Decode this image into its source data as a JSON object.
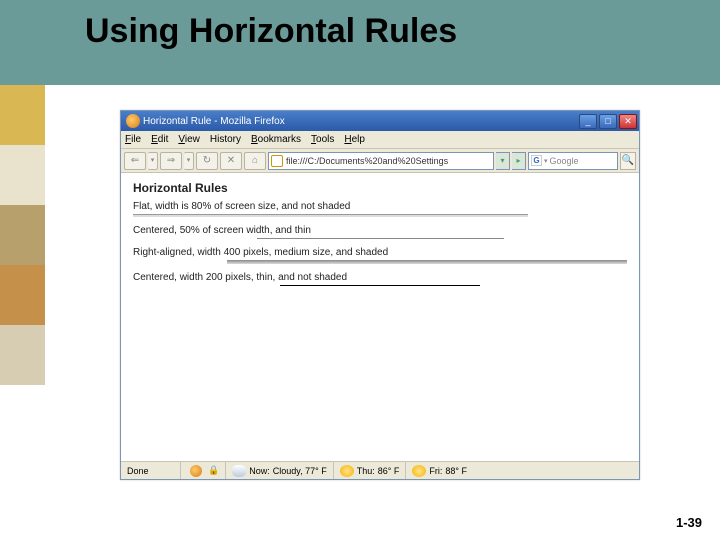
{
  "slide": {
    "title": "Using Horizontal Rules",
    "pagenum": "1-39"
  },
  "sidebar_colors": [
    "#d9b854",
    "#e9e2cc",
    "#b8a06c",
    "#c4904a",
    "#d6cdb2"
  ],
  "browser": {
    "title": "Horizontal Rule - Mozilla Firefox",
    "menu": {
      "file": "File",
      "edit": "Edit",
      "view": "View",
      "history": "History",
      "bookmarks": "Bookmarks",
      "tools": "Tools",
      "help": "Help"
    },
    "nav": {
      "back": "⇐",
      "fwd": "⇒",
      "reload": "↻",
      "stop": "✕",
      "home": "⌂",
      "url": "file:///C:/Documents%20and%20Settings",
      "go": "▸",
      "search_engine": "G",
      "search_placeholder": "Google",
      "mag": "🔍"
    },
    "page": {
      "heading": "Horizontal Rules",
      "p1": "Flat, width is 80% of screen size, and not shaded",
      "p2": "Centered, 50% of screen width, and thin",
      "p3": "Right-aligned, width 400 pixels, medium size, and shaded",
      "p4": "Centered, width 200 pixels, thin, and not shaded"
    },
    "status": {
      "done": "Done",
      "now_label": "Now:",
      "now_val": "Cloudy, 77° F",
      "thu_label": "Thu:",
      "thu_val": "86° F",
      "fri_label": "Fri:",
      "fri_val": "88° F"
    }
  }
}
